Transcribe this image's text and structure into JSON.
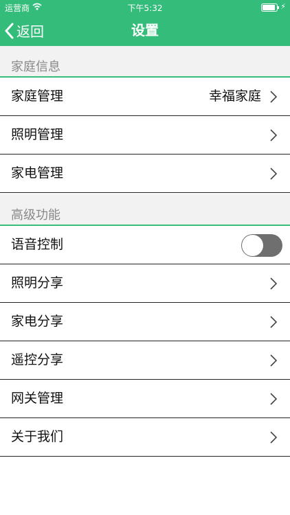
{
  "status_bar": {
    "carrier": "运营商",
    "time": "下午5:32"
  },
  "nav": {
    "back_label": "返回",
    "title": "设置"
  },
  "sections": [
    {
      "title": "家庭信息",
      "rows": [
        {
          "label": "家庭管理",
          "value": "幸福家庭"
        },
        {
          "label": "照明管理"
        },
        {
          "label": "家电管理"
        }
      ]
    },
    {
      "title": "高级功能",
      "rows": [
        {
          "label": "语音控制",
          "toggle": "off"
        },
        {
          "label": "照明分享"
        },
        {
          "label": "家电分享"
        },
        {
          "label": "遥控分享"
        },
        {
          "label": "网关管理"
        },
        {
          "label": "关于我们"
        }
      ]
    }
  ],
  "colors": {
    "accent": "#34bd7a",
    "toggle_off": "#6f6f6f"
  }
}
